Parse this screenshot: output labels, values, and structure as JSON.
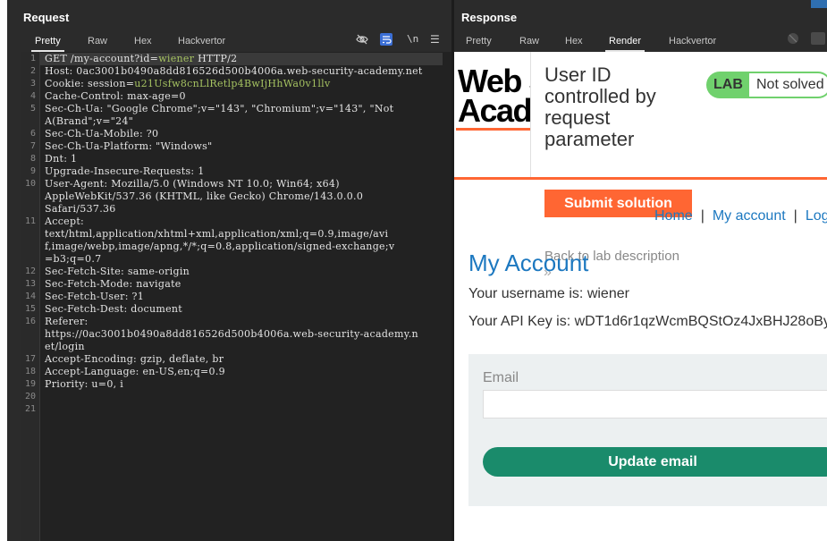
{
  "request": {
    "title": "Request",
    "tabs": [
      "Pretty",
      "Raw",
      "Hex",
      "Hackvertor"
    ],
    "newline_label": "\\n",
    "lines": [
      {
        "n": "1",
        "k": "GET /my-account?id=",
        "v": "wiener",
        "rest": " HTTP/2",
        "hl": true
      },
      {
        "n": "2",
        "k": "Host: ",
        "v": "0ac3001b0490a8dd816526d500b4006a.web-security-academy.net"
      },
      {
        "n": "3",
        "k": "Cookie: session=",
        "v": "u21Usfw8cnLlRetlp4BwIjHhWa0v1llv",
        "hl": true
      },
      {
        "n": "4",
        "k": "Cache-Control: ",
        "v": "max-age=0"
      },
      {
        "n": "5",
        "k": "Sec-Ch-Ua: ",
        "v": "\"Google Chrome\";v=\"143\", \"Chromium\";v=\"143\", \"Not"
      },
      {
        "n": "",
        "k": "",
        "v": "A(Brand\";v=\"24\""
      },
      {
        "n": "6",
        "k": "Sec-Ch-Ua-Mobile: ",
        "v": "?0"
      },
      {
        "n": "7",
        "k": "Sec-Ch-Ua-Platform: ",
        "v": "\"Windows\""
      },
      {
        "n": "8",
        "k": "Dnt: ",
        "v": "1"
      },
      {
        "n": "9",
        "k": "Upgrade-Insecure-Requests: ",
        "v": "1"
      },
      {
        "n": "10",
        "k": "User-Agent: ",
        "v": "Mozilla/5.0 (Windows NT 10.0; Win64; x64)"
      },
      {
        "n": "",
        "k": "",
        "v": "AppleWebKit/537.36 (KHTML, like Gecko) Chrome/143.0.0.0"
      },
      {
        "n": "",
        "k": "",
        "v": "Safari/537.36"
      },
      {
        "n": "11",
        "k": "Accept: ",
        "v": ""
      },
      {
        "n": "",
        "k": "",
        "v": "text/html,application/xhtml+xml,application/xml;q=0.9,image/avi"
      },
      {
        "n": "",
        "k": "",
        "v": "f,image/webp,image/apng,*/*;q=0.8,application/signed-exchange;v"
      },
      {
        "n": "",
        "k": "",
        "v": "=b3;q=0.7"
      },
      {
        "n": "12",
        "k": "Sec-Fetch-Site: ",
        "v": "same-origin"
      },
      {
        "n": "13",
        "k": "Sec-Fetch-Mode: ",
        "v": "navigate"
      },
      {
        "n": "14",
        "k": "Sec-Fetch-User: ",
        "v": "?1"
      },
      {
        "n": "15",
        "k": "Sec-Fetch-Dest: ",
        "v": "document"
      },
      {
        "n": "16",
        "k": "Referer: ",
        "v": ""
      },
      {
        "n": "",
        "k": "",
        "v": "https://0ac3001b0490a8dd816526d500b4006a.web-security-academy.n"
      },
      {
        "n": "",
        "k": "",
        "v": "et/login"
      },
      {
        "n": "17",
        "k": "Accept-Encoding: ",
        "v": "gzip, deflate, br"
      },
      {
        "n": "18",
        "k": "Accept-Language: ",
        "v": "en-US,en;q=0.9"
      },
      {
        "n": "19",
        "k": "Priority: ",
        "v": "u=0, i"
      },
      {
        "n": "20",
        "k": "",
        "v": ""
      },
      {
        "n": "21",
        "k": "",
        "v": ""
      }
    ]
  },
  "response": {
    "title": "Response",
    "tabs": [
      "Pretty",
      "Raw",
      "Hex",
      "Render",
      "Hackvertor"
    ],
    "render": {
      "logo_line1": "Web S",
      "logo_line2": "Acad",
      "lab_title": "User ID controlled by request parameter",
      "lab_badge_label": "LAB",
      "lab_status": "Not solved",
      "submit_label": "Submit solution",
      "back_label": "Back to lab description",
      "back_chevron": "»",
      "nav": {
        "home": "Home",
        "sep": "|",
        "my_account": "My account",
        "logout": "Log"
      },
      "heading": "My Account",
      "username_line": "Your username is: wiener",
      "apikey_line": "Your API Key is: wDT1d6r1qzWcmBQStOz4JxBHJ28oBy",
      "email_label": "Email",
      "email_value": "",
      "update_label": "Update email"
    }
  },
  "colors": {
    "accent_orange": "#ff6633",
    "link_blue": "#1c78c0",
    "button_green": "#1a8b6b",
    "badge_green": "#70d16d",
    "editor_bg": "#222222"
  }
}
